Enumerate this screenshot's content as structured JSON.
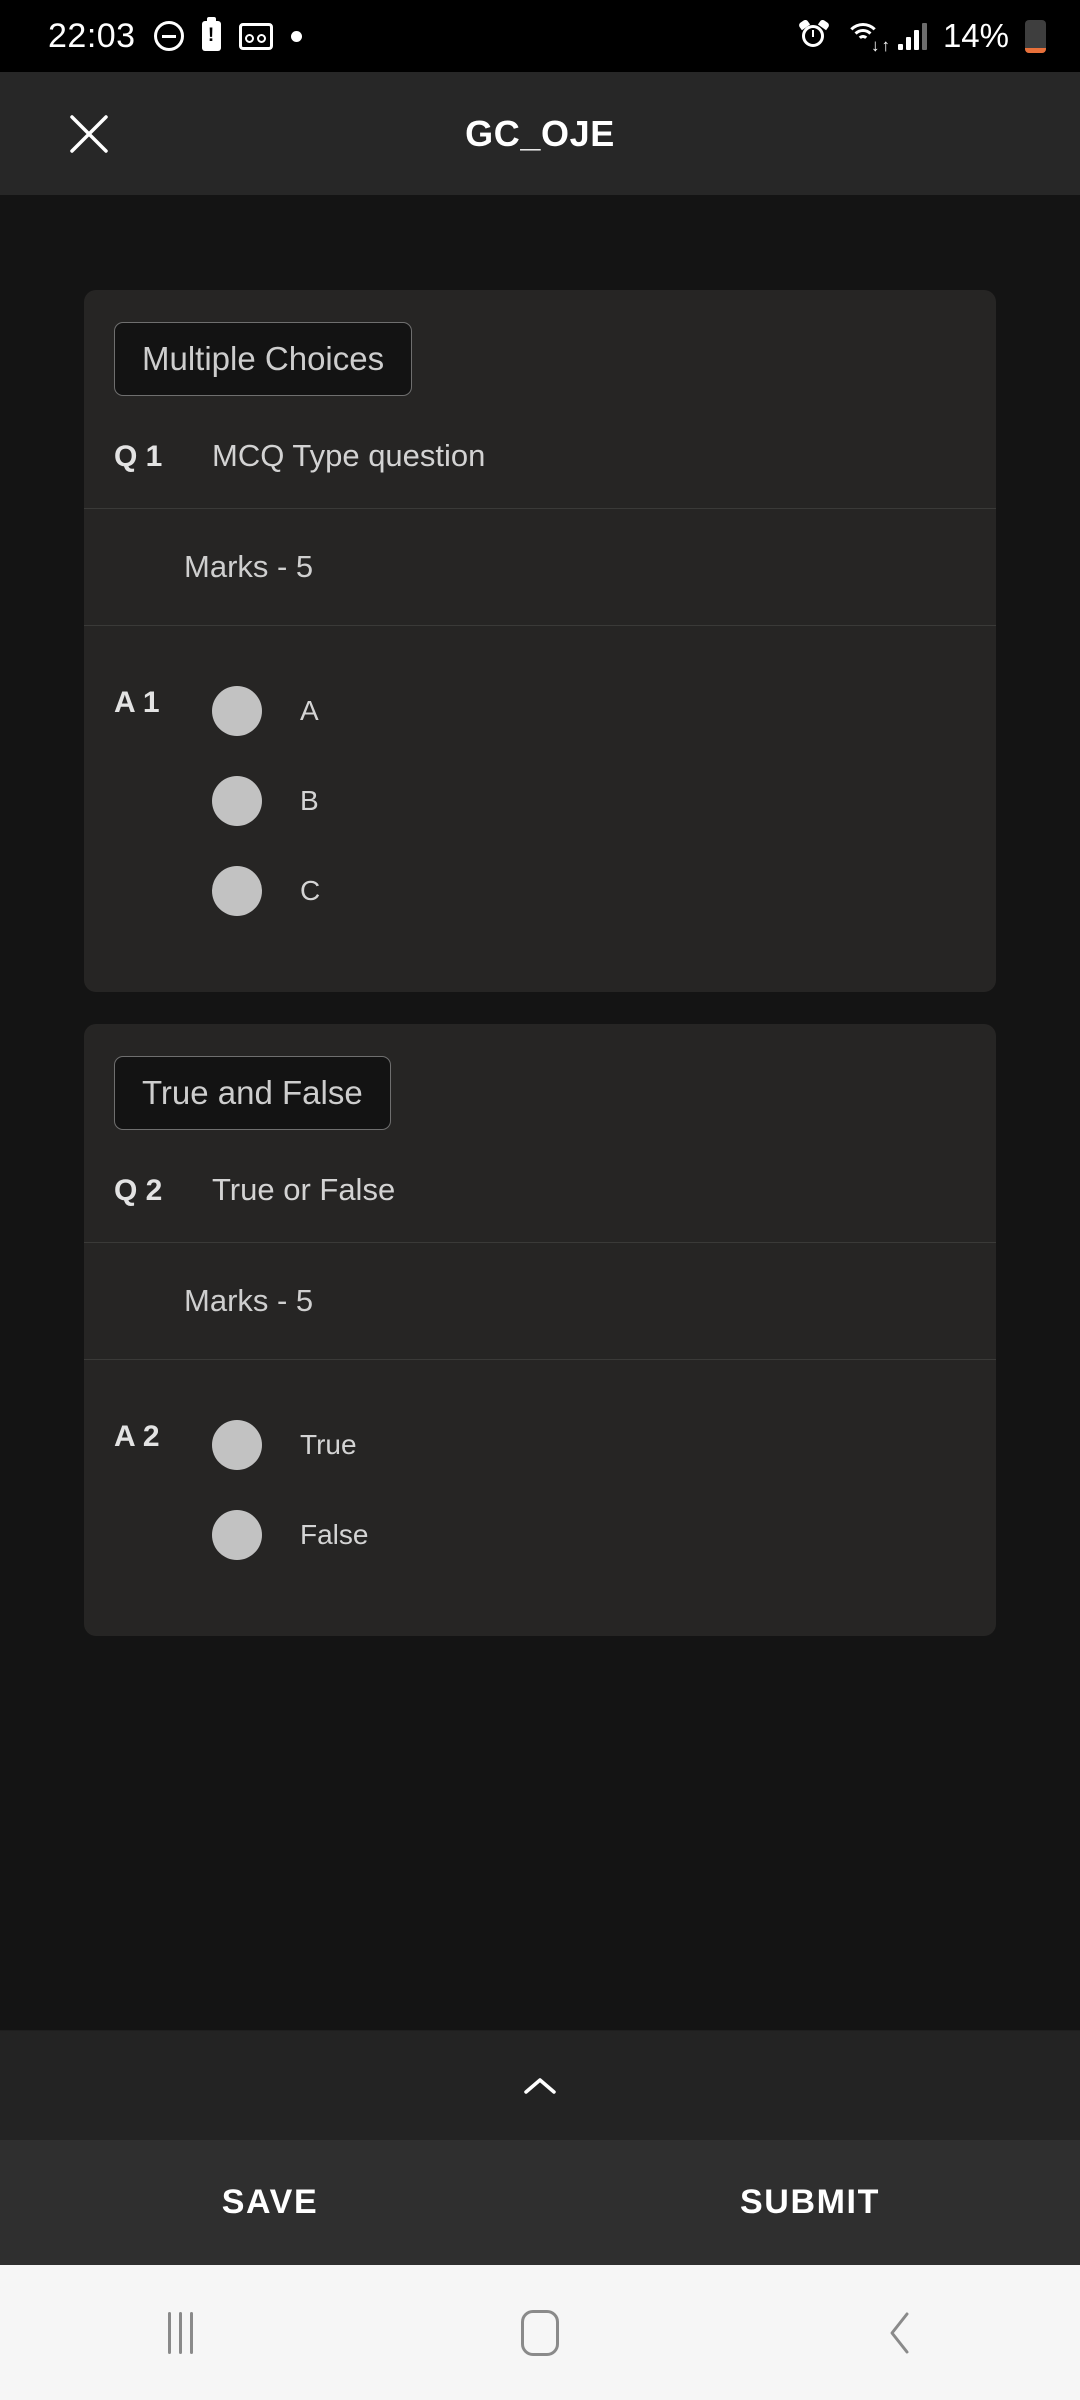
{
  "status_bar": {
    "time": "22:03",
    "left_icons": [
      "do-not-disturb-icon",
      "battery-alert-icon",
      "voicemail-icon",
      "dot-indicator-icon"
    ],
    "right_icons": [
      "alarm-icon",
      "wifi-icon",
      "signal-bars-icon"
    ],
    "battery_percent": "14%",
    "battery_level": 14,
    "accent_battery": "#e8703a"
  },
  "app_bar": {
    "close_icon": "close-icon",
    "title": "GC_OJE"
  },
  "questions": [
    {
      "badge": "Multiple Choices",
      "q_label": "Q 1",
      "q_text": "MCQ Type question",
      "marks": "Marks - 5",
      "a_label": "A 1",
      "options": [
        {
          "label": "A",
          "selected": false
        },
        {
          "label": "B",
          "selected": false
        },
        {
          "label": "C",
          "selected": false
        }
      ]
    },
    {
      "badge": "True and False",
      "q_label": "Q 2",
      "q_text": "True or False",
      "marks": "Marks - 5",
      "a_label": "A 2",
      "options": [
        {
          "label": "True",
          "selected": false
        },
        {
          "label": "False",
          "selected": false
        }
      ]
    }
  ],
  "expand_panel": {
    "icon": "chevron-up-icon"
  },
  "action_bar": {
    "save_label": "SAVE",
    "submit_label": "SUBMIT"
  },
  "nav_bar": {
    "recents_icon": "recents-icon",
    "home_icon": "home-icon",
    "back_icon": "back-icon"
  },
  "colors": {
    "page_background": "#141414",
    "card_background": "#262524",
    "app_bar_background": "#272727",
    "action_bar_background": "#2f2f2f",
    "radio_fill": "#c2c2c2"
  }
}
